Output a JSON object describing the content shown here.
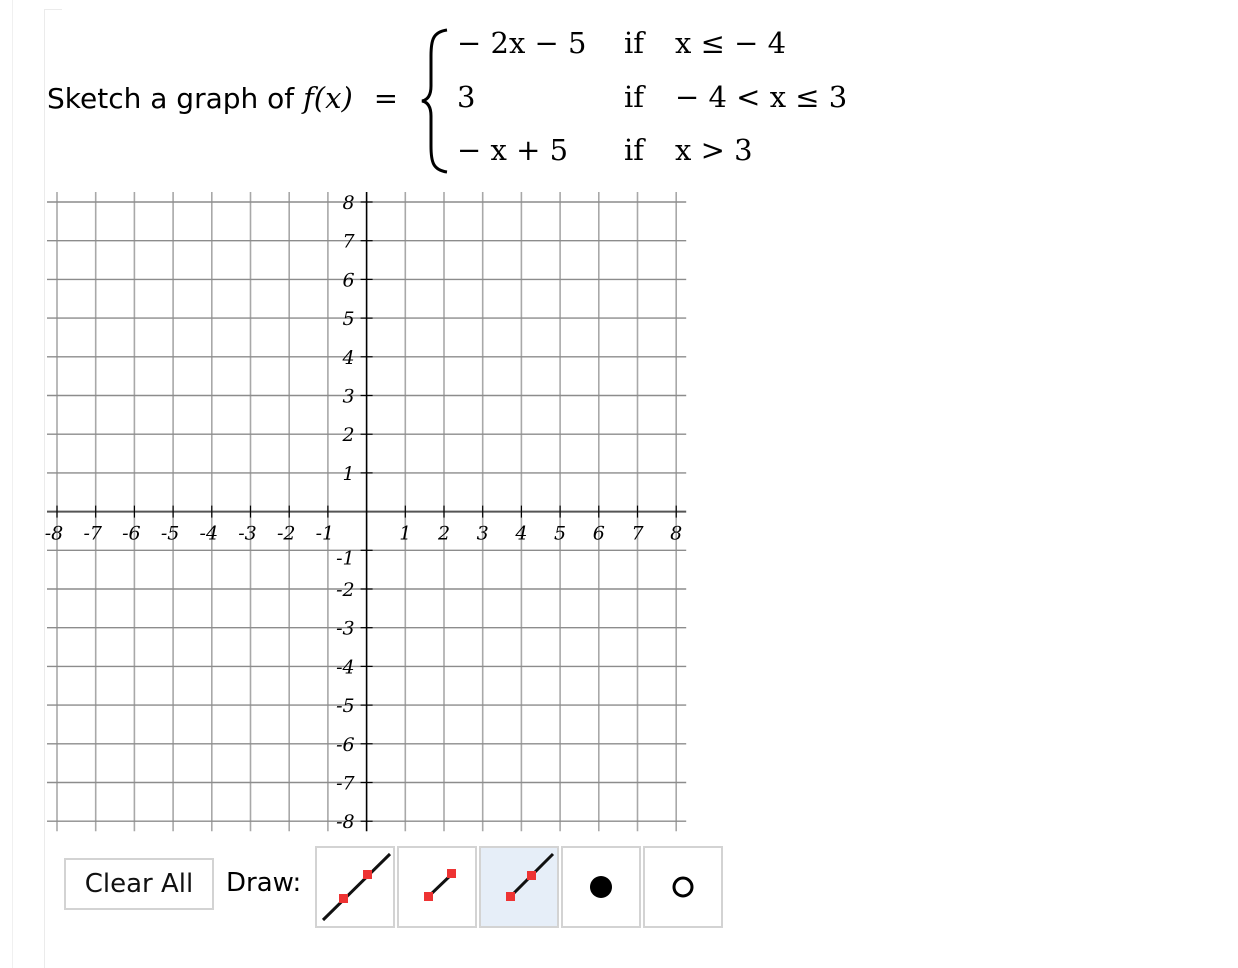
{
  "question": {
    "prompt_text": "Sketch a graph of",
    "function_name": "f(x)",
    "equals": "=",
    "cases": [
      {
        "expression": "− 2x − 5",
        "if": "if",
        "condition": "x ≤  − 4"
      },
      {
        "expression": "3",
        "if": "if",
        "condition": "− 4 < x ≤ 3"
      },
      {
        "expression": "− x + 5",
        "if": "if",
        "condition": "x > 3"
      }
    ]
  },
  "graph": {
    "x_min": -8,
    "x_max": 8,
    "y_min": -8,
    "y_max": 8,
    "step": 1,
    "x_tick_labels": [
      "-8",
      "-7",
      "-6",
      "-5",
      "-4",
      "-3",
      "-2",
      "-1",
      "1",
      "2",
      "3",
      "4",
      "5",
      "6",
      "7",
      "8"
    ],
    "y_tick_labels": [
      "8",
      "7",
      "6",
      "5",
      "4",
      "3",
      "2",
      "1",
      "-1",
      "-2",
      "-3",
      "-4",
      "-5",
      "-6",
      "-7",
      "-8"
    ],
    "grid_color": "#8c8c8c",
    "axis_color": "#000000"
  },
  "controls": {
    "clear_all_label": "Clear All",
    "draw_label": "Draw:",
    "tools": [
      {
        "name": "line-tool",
        "icon": "line-icon",
        "selected": false
      },
      {
        "name": "segment-tool",
        "icon": "segment-icon",
        "selected": false
      },
      {
        "name": "ray-tool",
        "icon": "ray-icon",
        "selected": true
      },
      {
        "name": "closed-dot-tool",
        "icon": "closed-dot-icon",
        "selected": false
      },
      {
        "name": "open-dot-tool",
        "icon": "open-dot-icon",
        "selected": false
      }
    ],
    "selected_color": "#e6eef8",
    "point_color": "#ee3333"
  }
}
